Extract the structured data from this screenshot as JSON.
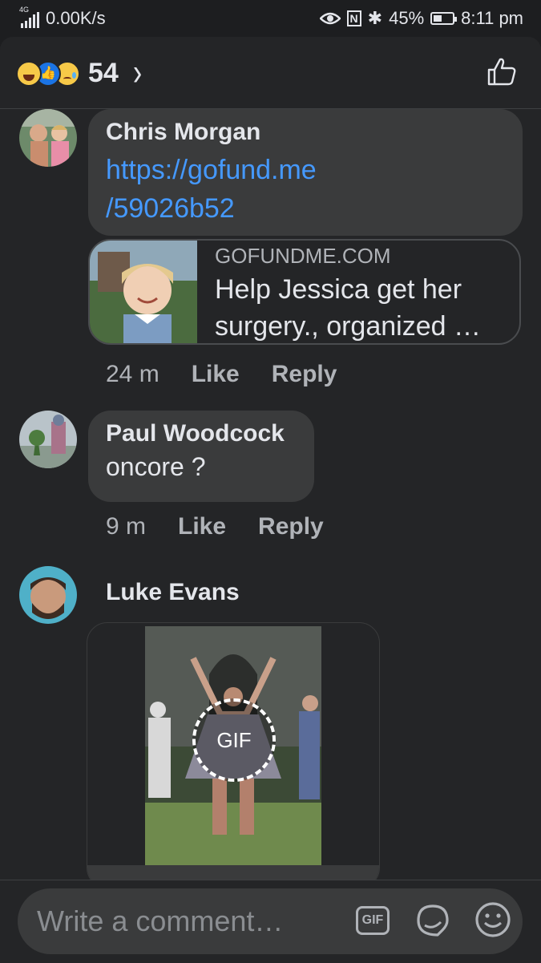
{
  "status_bar": {
    "network": "4G",
    "speed": "0.00K/s",
    "battery": "45%",
    "battery_level": 0.45,
    "time": "8:11 pm"
  },
  "header": {
    "reaction_count": "54",
    "reactions": [
      "haha-icon",
      "like-icon",
      "sad-icon"
    ]
  },
  "comments": [
    {
      "author": "Chris Morgan",
      "link_line1": "https://gofund.me",
      "link_line2": "/59026b52",
      "preview": {
        "domain": "GOFUNDME.COM",
        "title": "Help Jessica get her surgery., organized …"
      },
      "time": "24 m",
      "like": "Like",
      "reply": "Reply"
    },
    {
      "author": "Paul Woodcock",
      "text": "oncore ?",
      "time": "9 m",
      "like": "Like",
      "reply": "Reply"
    },
    {
      "author": "Luke Evans",
      "gif_label": "GIF"
    }
  ],
  "composer": {
    "placeholder": "Write a comment…",
    "gif_label": "GIF"
  },
  "colors": {
    "background": "#242527",
    "bubble": "#3a3b3c",
    "link": "#4599ff",
    "secondary_text": "#b0b3b8"
  }
}
